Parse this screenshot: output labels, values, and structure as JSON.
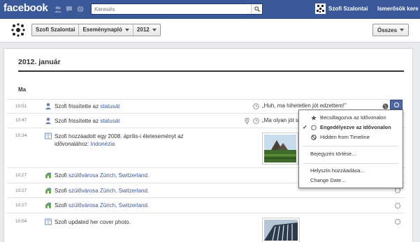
{
  "topbar": {
    "logo": "facebook",
    "search_placeholder": "Keresés",
    "user_name": "Szofi Szalontai",
    "friends_link": "Ismerősök kere",
    "bg_color": "#3b5998"
  },
  "subbar": {
    "crumbs": [
      "Szofi Szalontai",
      "Eseménynapló",
      "2012"
    ],
    "filter_label": "Összes"
  },
  "timeline": {
    "section_title": "2012. január",
    "day_label": "Ma",
    "rows": [
      {
        "time": "10:51",
        "icon": "person-icon",
        "text_plain": "Szofi frissítette az ",
        "text_link": "statusát",
        "preview": "„Huh, ma hihetetlen jót edzettem!”"
      },
      {
        "time": "10:47",
        "icon": "person-icon",
        "text_plain": "Szofi frissítette az ",
        "text_link": "statusát",
        "preview": "„Ma olyan jót s"
      },
      {
        "time": "10:34",
        "icon": "book-icon",
        "text_plain": "Szofi hozzáadott egy 2008. április-i életeseményt az idővonalához: ",
        "text_link": "Indonézia"
      },
      {
        "time": "10:27",
        "icon": "home-icon",
        "text_plain": "Szofi ",
        "text_link": "szülővárosa Zürich, Switzerland."
      },
      {
        "time": "10:27",
        "icon": "home-icon",
        "text_plain": "Szofi ",
        "text_link": "szülővárosa Zürich, Switzerland."
      },
      {
        "time": "10:27",
        "icon": "home-icon",
        "text_plain": "Szofi ",
        "text_link": "szülővárosa Zürich, Switzerland."
      },
      {
        "time": "10:04",
        "icon": "book-icon",
        "text_plain": "Szofi updated her cover photo.",
        "text_link": ""
      }
    ]
  },
  "menu": {
    "items": [
      {
        "label": "Becsillagozva az Idővonalon",
        "icon": "star-icon"
      },
      {
        "label": "Engedélyezve az Idővonalon",
        "icon": "circle-icon",
        "checked": true
      },
      {
        "label": "Hidden from Timeline",
        "icon": "no-entry-icon"
      },
      {
        "label": "Bejegyzés törlése..."
      },
      {
        "label": "Helyszín hozzáadása..."
      },
      {
        "label": "Change Date..."
      }
    ]
  }
}
